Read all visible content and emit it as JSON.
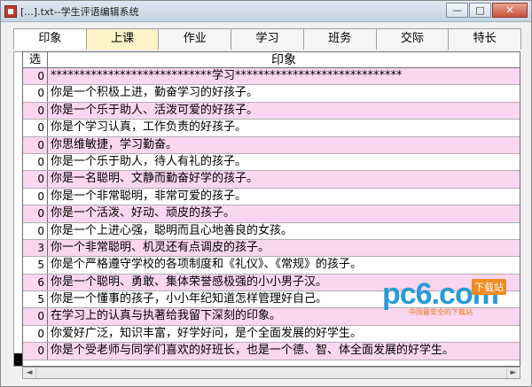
{
  "window": {
    "title": "[...].txt--学生评语编辑系统"
  },
  "controls": {
    "minimize": "—",
    "maximize": "□",
    "close": "✕"
  },
  "tabs": [
    {
      "label": "印象",
      "state": "active"
    },
    {
      "label": "上课",
      "state": "hover"
    },
    {
      "label": "作业",
      "state": "normal"
    },
    {
      "label": "学习",
      "state": "normal"
    },
    {
      "label": "班务",
      "state": "normal"
    },
    {
      "label": "交际",
      "state": "normal"
    },
    {
      "label": "特长",
      "state": "normal"
    }
  ],
  "grid": {
    "headers": {
      "sel": "选",
      "text": "印象"
    },
    "rows": [
      {
        "sel": "0",
        "text": "****************************学习*****************************",
        "bg": "pink"
      },
      {
        "sel": "0",
        "text": "你是一个积极上进，勤奋学习的好孩子。",
        "bg": "white"
      },
      {
        "sel": "0",
        "text": "你是一个乐于助人、活泼可爱的好孩子。",
        "bg": "pink"
      },
      {
        "sel": "0",
        "text": "你是个学习认真，工作负责的好孩子。",
        "bg": "white"
      },
      {
        "sel": "0",
        "text": "你思维敏捷，学习勤奋。",
        "bg": "pink"
      },
      {
        "sel": "0",
        "text": "你是一个乐于助人，待人有礼的孩子。",
        "bg": "white"
      },
      {
        "sel": "0",
        "text": "你是一名聪明、文静而勤奋好学的孩子。",
        "bg": "pink"
      },
      {
        "sel": "0",
        "text": "你是一个非常聪明，非常可爱的孩子。",
        "bg": "white"
      },
      {
        "sel": "0",
        "text": "你是一个活泼、好动、顽皮的孩子。",
        "bg": "pink"
      },
      {
        "sel": "0",
        "text": "你是一个上进心强，聪明而且心地善良的女孩。",
        "bg": "white"
      },
      {
        "sel": "3",
        "text": "你一个非常聪明、机灵还有点调皮的孩子。",
        "bg": "pink"
      },
      {
        "sel": "5",
        "text": "你是个严格遵守学校的各项制度和《礼仪》、《常规》的孩子。",
        "bg": "white"
      },
      {
        "sel": "6",
        "text": "你是一个聪明、勇敢、集体荣誉感极强的小小男子汉。",
        "bg": "pink"
      },
      {
        "sel": "5",
        "text": "你是一个懂事的孩子，小小年纪知道怎样管理好自己。",
        "bg": "white"
      },
      {
        "sel": "0",
        "text": "在学习上的认真与执著给我留下深刻的印象。",
        "bg": "pink"
      },
      {
        "sel": "0",
        "text": "你爱好广泛，知识丰富，好学好问，是个全面发展的好学生。",
        "bg": "white"
      },
      {
        "sel": "0",
        "text": "你是个受老师与同学们喜欢的好班长，也是一个德、智、体全面发展的好学生。",
        "bg": "pink"
      }
    ]
  },
  "scroll": {
    "left": "◄",
    "right": "►"
  },
  "watermark": {
    "brand": "pc6.com",
    "badge": "下载站",
    "sub": "中国最安全的下载站"
  }
}
